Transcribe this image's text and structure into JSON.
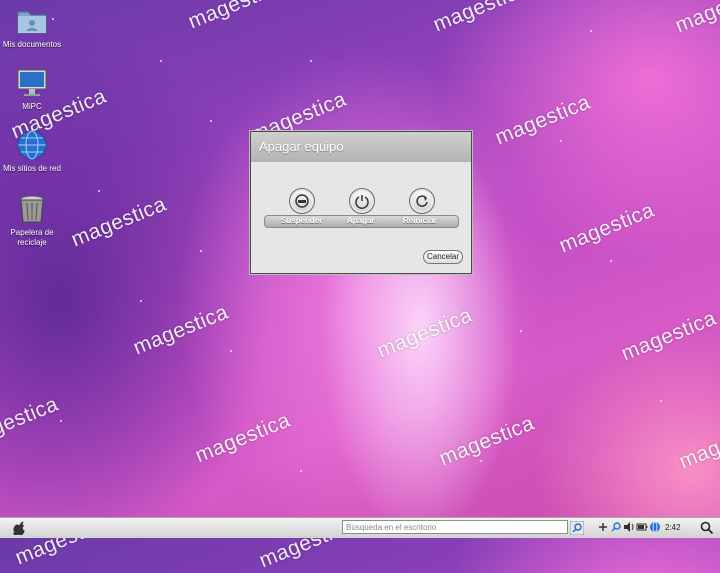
{
  "desktop": {
    "icons": [
      {
        "label": "Mis documentos",
        "icon": "folder-icon"
      },
      {
        "label": "MiPC",
        "icon": "monitor-icon"
      },
      {
        "label": "Mis sitios de red",
        "icon": "network-globe-icon"
      },
      {
        "label": "Papelera de reciclaje",
        "icon": "trash-icon"
      }
    ],
    "watermark": "magestica"
  },
  "dialog": {
    "title": "Apagar equipo",
    "options": [
      {
        "label": "Suspender",
        "icon": "suspend-icon"
      },
      {
        "label": "Apagar",
        "icon": "power-icon"
      },
      {
        "label": "Reiniciar",
        "icon": "restart-icon"
      }
    ],
    "cancel_label": "Cancelar"
  },
  "taskbar": {
    "search_placeholder": "Búsqueda en el escritorio",
    "clock": "2:42",
    "tray_icons": [
      "add-icon",
      "search-tray-icon",
      "volume-icon",
      "battery-icon",
      "network-icon",
      "display-icon"
    ]
  },
  "colors": {
    "wallpaper_primary": "#c04cc4",
    "dialog_bg": "#e6e6e6",
    "taskbar_bg": "#e6e6e6"
  }
}
